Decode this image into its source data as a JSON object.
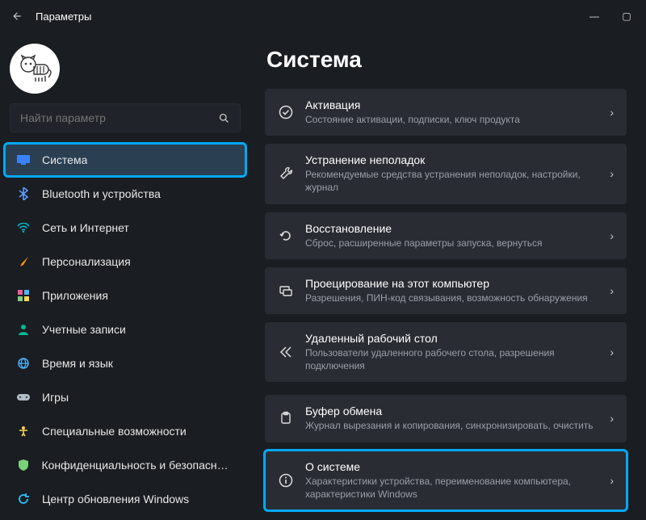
{
  "window": {
    "title": "Параметры"
  },
  "search": {
    "placeholder": "Найти параметр"
  },
  "sidebar": {
    "items": [
      {
        "key": "system",
        "label": "Система"
      },
      {
        "key": "bluetooth",
        "label": "Bluetooth и устройства"
      },
      {
        "key": "network",
        "label": "Сеть и Интернет"
      },
      {
        "key": "personalization",
        "label": "Персонализация"
      },
      {
        "key": "apps",
        "label": "Приложения"
      },
      {
        "key": "accounts",
        "label": "Учетные записи"
      },
      {
        "key": "time",
        "label": "Время и язык"
      },
      {
        "key": "gaming",
        "label": "Игры"
      },
      {
        "key": "accessibility",
        "label": "Специальные возможности"
      },
      {
        "key": "privacy",
        "label": "Конфиденциальность и безопасность"
      },
      {
        "key": "update",
        "label": "Центр обновления Windows"
      }
    ]
  },
  "main": {
    "title": "Система",
    "cards": [
      {
        "key": "activation",
        "title": "Активация",
        "sub": "Состояние активации, подписки, ключ продукта"
      },
      {
        "key": "troubleshoot",
        "title": "Устранение неполадок",
        "sub": "Рекомендуемые средства устранения неполадок, настройки, журнал"
      },
      {
        "key": "recovery",
        "title": "Восстановление",
        "sub": "Сброс, расширенные параметры запуска, вернуться"
      },
      {
        "key": "projecting",
        "title": "Проецирование на этот компьютер",
        "sub": "Разрешения, ПИН-код связывания, возможность обнаружения"
      },
      {
        "key": "remote",
        "title": "Удаленный рабочий стол",
        "sub": "Пользователи удаленного рабочего стола, разрешения подключения"
      },
      {
        "key": "clipboard",
        "title": "Буфер обмена",
        "sub": "Журнал вырезания и копирования, синхронизировать, очистить"
      },
      {
        "key": "about",
        "title": "О системе",
        "sub": "Характеристики устройства, переименование компьютера, характеристики Windows"
      }
    ]
  }
}
